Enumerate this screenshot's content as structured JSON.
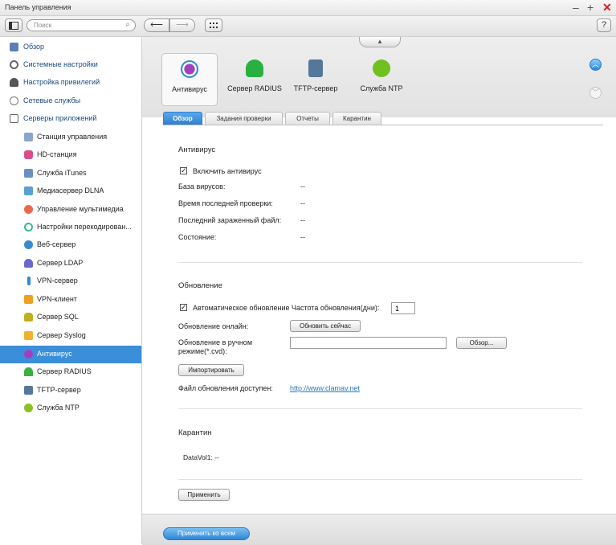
{
  "window": {
    "title": "Панель управления"
  },
  "toolbar": {
    "search_placeholder": "Поиск",
    "help": "?"
  },
  "sidebar": {
    "items": [
      {
        "label": "Обзор",
        "icon": "overview-icon",
        "color": "#5a7fb8"
      },
      {
        "label": "Системные настройки",
        "icon": "gear-icon",
        "color": "#666666"
      },
      {
        "label": "Настройка привилегий",
        "icon": "user-icon",
        "color": "#555555"
      },
      {
        "label": "Сетевые службы",
        "icon": "network-icon",
        "color": "#777777"
      },
      {
        "label": "Серверы приложений",
        "icon": "server-icon",
        "color": "#666666"
      }
    ],
    "subitems": [
      {
        "label": "Станция управления",
        "icon": "station-icon",
        "color": "#8aa6c8"
      },
      {
        "label": "HD-станция",
        "icon": "hd-station-icon",
        "color": "#d94c8c"
      },
      {
        "label": "Служба iTunes",
        "icon": "itunes-icon",
        "color": "#6a8fc0"
      },
      {
        "label": "Медиасервер DLNA",
        "icon": "dlna-icon",
        "color": "#5aa0d0"
      },
      {
        "label": "Управление мультимедиа",
        "icon": "multimedia-icon",
        "color": "#e86a4a"
      },
      {
        "label": "Настройки перекодирован...",
        "icon": "transcode-icon",
        "color": "#3bb890"
      },
      {
        "label": "Веб-сервер",
        "icon": "web-icon",
        "color": "#3a8ad0"
      },
      {
        "label": "Сервер LDAP",
        "icon": "ldap-icon",
        "color": "#6a6ac8"
      },
      {
        "label": "VPN-сервер",
        "icon": "vpn-server-icon",
        "color": "#2a88d8"
      },
      {
        "label": "VPN-клиент",
        "icon": "vpn-client-icon",
        "color": "#f0a020"
      },
      {
        "label": "Сервер SQL",
        "icon": "sql-icon",
        "color": "#c0b020"
      },
      {
        "label": "Сервер Syslog",
        "icon": "syslog-icon",
        "color": "#f0b030"
      },
      {
        "label": "Антивирус",
        "icon": "antivirus-icon",
        "color": "#a040c0"
      },
      {
        "label": "Сервер RADIUS",
        "icon": "radius-icon",
        "color": "#3ab040"
      },
      {
        "label": "TFTP-сервер",
        "icon": "tftp-icon",
        "color": "#557799"
      },
      {
        "label": "Служба NTP",
        "icon": "ntp-icon",
        "color": "#8ac020"
      }
    ]
  },
  "apps": [
    {
      "label": "Антивирус",
      "icon": "antivirus-icon",
      "color": "#a040c0"
    },
    {
      "label": "Сервер RADIUS",
      "icon": "radius-icon",
      "color": "#2ab040"
    },
    {
      "label": "TFTP-сервер",
      "icon": "tftp-icon",
      "color": "#557799"
    },
    {
      "label": "Служба NTP",
      "icon": "ntp-icon",
      "color": "#70c020"
    }
  ],
  "tabs": [
    "Обзор",
    "Задания проверки",
    "Отчеты",
    "Карантин"
  ],
  "antivirus": {
    "heading": "Антивирус",
    "enable_label": "Включить антивирус",
    "rows": [
      {
        "label": "База вирусов:",
        "value": "--"
      },
      {
        "label": "Время последней проверки:",
        "value": "--"
      },
      {
        "label": "Последний зараженный файл:",
        "value": "--"
      },
      {
        "label": "Состояние:",
        "value": "--"
      }
    ]
  },
  "update": {
    "heading": "Обновление",
    "auto_label": "Автоматическое обновление Частота обновления(дни):",
    "frequency": "1",
    "online_label": "Обновление онлайн:",
    "update_now": "Обновить сейчас",
    "manual_label": "Обновление в ручном режиме(*.cvd):",
    "browse": "Обзор...",
    "import": "Импортировать",
    "file_available_label": "Файл обновления доступен:",
    "file_link": "http://www.clamav.net"
  },
  "quarantine": {
    "heading": "Карантин",
    "volume": "DataVol1: --"
  },
  "buttons": {
    "apply": "Применить",
    "apply_all": "Применить ко всем"
  },
  "colors": {
    "accent": "#3a8fd8",
    "close": "#d22020"
  }
}
